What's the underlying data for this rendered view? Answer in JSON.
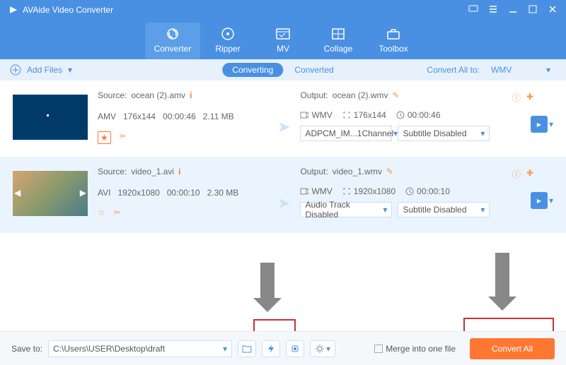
{
  "app": {
    "title": "AVAide Video Converter"
  },
  "tabs": [
    "Converter",
    "Ripper",
    "MV",
    "Collage",
    "Toolbox"
  ],
  "subbar": {
    "add": "Add Files",
    "converting": "Converting",
    "converted": "Converted",
    "convert_all_to": "Convert All to:",
    "format": "WMV"
  },
  "files": [
    {
      "source_label": "Source:",
      "source_name": "ocean (2).amv",
      "codec": "AMV",
      "res": "176x144",
      "dur": "00:00:46",
      "size": "2.11 MB",
      "output_label": "Output:",
      "output_name": "ocean (2).wmv",
      "out_fmt": "WMV",
      "out_res": "176x144",
      "out_dur": "00:00:46",
      "audio": "ADPCM_IM...1Channel",
      "subtitle": "Subtitle Disabled"
    },
    {
      "source_label": "Source:",
      "source_name": "video_1.avi",
      "codec": "AVI",
      "res": "1920x1080",
      "dur": "00:00:10",
      "size": "2.30 MB",
      "output_label": "Output:",
      "output_name": "video_1.wmv",
      "out_fmt": "WMV",
      "out_res": "1920x1080",
      "out_dur": "00:00:10",
      "audio": "Audio Track Disabled",
      "subtitle": "Subtitle Disabled"
    }
  ],
  "bottom": {
    "save_to": "Save to:",
    "path": "C:\\Users\\USER\\Desktop\\draft",
    "merge": "Merge into one file",
    "convert": "Convert All"
  }
}
